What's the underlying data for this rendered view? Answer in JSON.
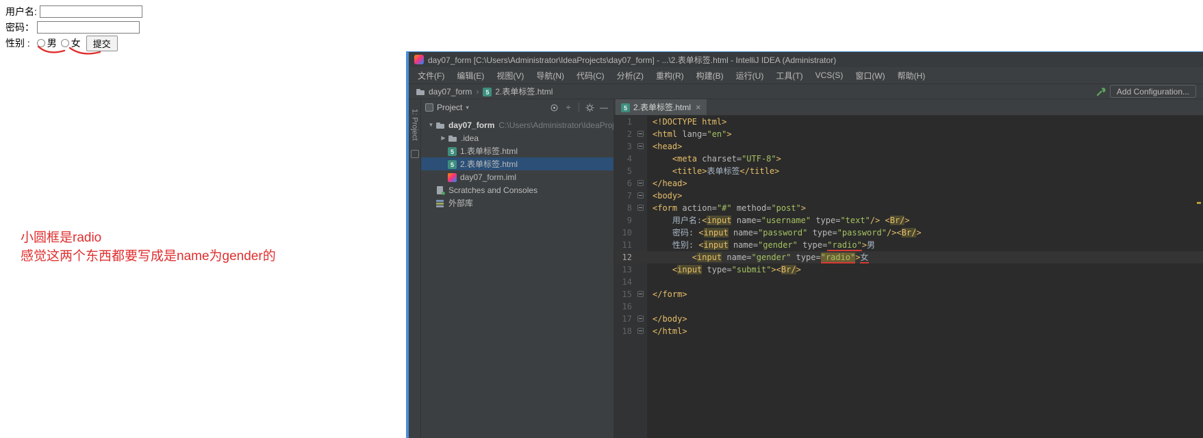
{
  "form": {
    "username_label": "用户名:",
    "password_label": "密码：",
    "gender_label": "性别 :",
    "male_label": "男",
    "female_label": "女",
    "submit_label": "提交",
    "username_value": "",
    "password_value": ""
  },
  "notes": {
    "line1": "小圆框是radio",
    "line2": "感觉这两个东西都要写成是name为gender的"
  },
  "ide": {
    "title": "day07_form [C:\\Users\\Administrator\\IdeaProjects\\day07_form] - ...\\2.表单标签.html - IntelliJ IDEA (Administrator)",
    "menu": [
      "文件(F)",
      "编辑(E)",
      "视图(V)",
      "导航(N)",
      "代码(C)",
      "分析(Z)",
      "重构(R)",
      "构建(B)",
      "运行(U)",
      "工具(T)",
      "VCS(S)",
      "窗口(W)",
      "帮助(H)"
    ],
    "breadcrumb": {
      "project": "day07_form",
      "file": "2.表单标签.html",
      "separator": "›"
    },
    "add_configuration": "Add Configuration...",
    "tool_strip_label": "1: Project",
    "glyphs": {
      "chevron_down": "▾",
      "arrow_down": "▼",
      "arrow_right": "▶",
      "close": "×",
      "collapse_all": "÷",
      "minimize": "—"
    },
    "project_panel": {
      "title": "Project",
      "tree": [
        {
          "label": "day07_form",
          "path": "C:\\Users\\Administrator\\IdeaProjec",
          "icon": "folder",
          "arrow": "down",
          "indent": 0,
          "bold": true
        },
        {
          "label": ".idea",
          "icon": "folder",
          "arrow": "right",
          "indent": 1
        },
        {
          "label": "1.表单标签.html",
          "icon": "html",
          "indent": 1
        },
        {
          "label": "2.表单标签.html",
          "icon": "html",
          "indent": 1,
          "selected": true
        },
        {
          "label": "day07_form.iml",
          "icon": "iml",
          "indent": 1
        },
        {
          "label": "Scratches and Consoles",
          "icon": "scratch",
          "indent": 0
        },
        {
          "label": "外部库",
          "icon": "lib",
          "indent": 0
        }
      ]
    },
    "tab": {
      "label": "2.表单标签.html"
    },
    "code": {
      "current_line": 12,
      "lines": [
        {
          "n": 1,
          "tokens": [
            {
              "t": "<!DOCTYPE html>",
              "c": "tag"
            }
          ]
        },
        {
          "n": 2,
          "fold": true,
          "tokens": [
            {
              "t": "<html ",
              "c": "tag"
            },
            {
              "t": "lang=",
              "c": "attr"
            },
            {
              "t": "\"en\"",
              "c": "str"
            },
            {
              "t": ">",
              "c": "tag"
            }
          ]
        },
        {
          "n": 3,
          "fold": true,
          "tokens": [
            {
              "t": "<head>",
              "c": "tag"
            }
          ]
        },
        {
          "n": 4,
          "tokens": [
            {
              "t": "    ",
              "c": "txt"
            },
            {
              "t": "<meta ",
              "c": "tag"
            },
            {
              "t": "charset=",
              "c": "attr"
            },
            {
              "t": "\"UTF-8\"",
              "c": "str"
            },
            {
              "t": ">",
              "c": "tag"
            }
          ]
        },
        {
          "n": 5,
          "tokens": [
            {
              "t": "    ",
              "c": "txt"
            },
            {
              "t": "<title>",
              "c": "tag"
            },
            {
              "t": "表单标签",
              "c": "txt"
            },
            {
              "t": "</title>",
              "c": "tag"
            }
          ]
        },
        {
          "n": 6,
          "fold": true,
          "tokens": [
            {
              "t": "</head>",
              "c": "tag"
            }
          ]
        },
        {
          "n": 7,
          "fold": true,
          "tokens": [
            {
              "t": "<body>",
              "c": "tag"
            }
          ]
        },
        {
          "n": 8,
          "fold": true,
          "tokens": [
            {
              "t": "<form ",
              "c": "tag"
            },
            {
              "t": "action=",
              "c": "attr"
            },
            {
              "t": "\"#\"",
              "c": "str"
            },
            {
              "t": " ",
              "c": "txt"
            },
            {
              "t": "method=",
              "c": "attr"
            },
            {
              "t": "\"post\"",
              "c": "str"
            },
            {
              "t": ">",
              "c": "tag"
            }
          ]
        },
        {
          "n": 9,
          "tokens": [
            {
              "t": "    用户名:",
              "c": "txt"
            },
            {
              "t": "<",
              "c": "tag"
            },
            {
              "t": "input",
              "c": "tag hl"
            },
            {
              "t": " ",
              "c": "txt"
            },
            {
              "t": "name=",
              "c": "attr"
            },
            {
              "t": "\"username\"",
              "c": "str"
            },
            {
              "t": " ",
              "c": "txt"
            },
            {
              "t": "type=",
              "c": "attr"
            },
            {
              "t": "\"text\"",
              "c": "str"
            },
            {
              "t": "/> ",
              "c": "tag"
            },
            {
              "t": "<",
              "c": "tag"
            },
            {
              "t": "Br/",
              "c": "tag hl"
            },
            {
              "t": ">",
              "c": "tag"
            }
          ]
        },
        {
          "n": 10,
          "tokens": [
            {
              "t": "    密码: ",
              "c": "txt"
            },
            {
              "t": "<",
              "c": "tag"
            },
            {
              "t": "input",
              "c": "tag hl"
            },
            {
              "t": " ",
              "c": "txt"
            },
            {
              "t": "name=",
              "c": "attr"
            },
            {
              "t": "\"password\"",
              "c": "str"
            },
            {
              "t": " ",
              "c": "txt"
            },
            {
              "t": "type=",
              "c": "attr"
            },
            {
              "t": "\"password\"",
              "c": "str"
            },
            {
              "t": "/>",
              "c": "tag"
            },
            {
              "t": "<",
              "c": "tag"
            },
            {
              "t": "Br/",
              "c": "tag hl"
            },
            {
              "t": ">",
              "c": "tag"
            }
          ]
        },
        {
          "n": 11,
          "tokens": [
            {
              "t": "    性别: ",
              "c": "txt"
            },
            {
              "t": "<",
              "c": "tag"
            },
            {
              "t": "input",
              "c": "tag hl"
            },
            {
              "t": " ",
              "c": "txt"
            },
            {
              "t": "name=",
              "c": "attr"
            },
            {
              "t": "\"gender\"",
              "c": "str"
            },
            {
              "t": " ",
              "c": "txt"
            },
            {
              "t": "type=",
              "c": "attr"
            },
            {
              "t": "\"radio\"",
              "c": "str",
              "u": true
            },
            {
              "t": ">",
              "c": "tag"
            },
            {
              "t": "男",
              "c": "txt"
            }
          ]
        },
        {
          "n": 12,
          "tokens": [
            {
              "t": "        ",
              "c": "txt"
            },
            {
              "t": "<",
              "c": "tag"
            },
            {
              "t": "input",
              "c": "tag hl"
            },
            {
              "t": " ",
              "c": "txt"
            },
            {
              "t": "name=",
              "c": "attr"
            },
            {
              "t": "\"gender\"",
              "c": "str"
            },
            {
              "t": " ",
              "c": "txt"
            },
            {
              "t": "type=",
              "c": "attr"
            },
            {
              "t": "\"radio\"",
              "c": "str hl2",
              "u": true
            },
            {
              "t": ">",
              "c": "tag"
            },
            {
              "t": "女",
              "c": "txt",
              "u": true
            }
          ]
        },
        {
          "n": 13,
          "tokens": [
            {
              "t": "    ",
              "c": "txt"
            },
            {
              "t": "<",
              "c": "tag"
            },
            {
              "t": "input",
              "c": "tag hl"
            },
            {
              "t": " ",
              "c": "txt"
            },
            {
              "t": "type=",
              "c": "attr"
            },
            {
              "t": "\"submit\"",
              "c": "str"
            },
            {
              "t": ">",
              "c": "tag"
            },
            {
              "t": "<",
              "c": "tag"
            },
            {
              "t": "Br/",
              "c": "tag hl"
            },
            {
              "t": ">",
              "c": "tag"
            }
          ]
        },
        {
          "n": 14,
          "tokens": []
        },
        {
          "n": 15,
          "fold": true,
          "tokens": [
            {
              "t": "</form>",
              "c": "tag"
            }
          ]
        },
        {
          "n": 16,
          "tokens": []
        },
        {
          "n": 17,
          "fold": true,
          "tokens": [
            {
              "t": "</body>",
              "c": "tag"
            }
          ]
        },
        {
          "n": 18,
          "fold": true,
          "tokens": [
            {
              "t": "</html>",
              "c": "tag"
            }
          ]
        }
      ]
    },
    "colors": {
      "annotation_red": "#d83a34",
      "selection_blue": "#2b4f76",
      "tag_yellow": "#e8bf6a",
      "string_green": "#a5c261",
      "editor_bg": "#2b2b2b",
      "panel_bg": "#3c3f41"
    }
  }
}
